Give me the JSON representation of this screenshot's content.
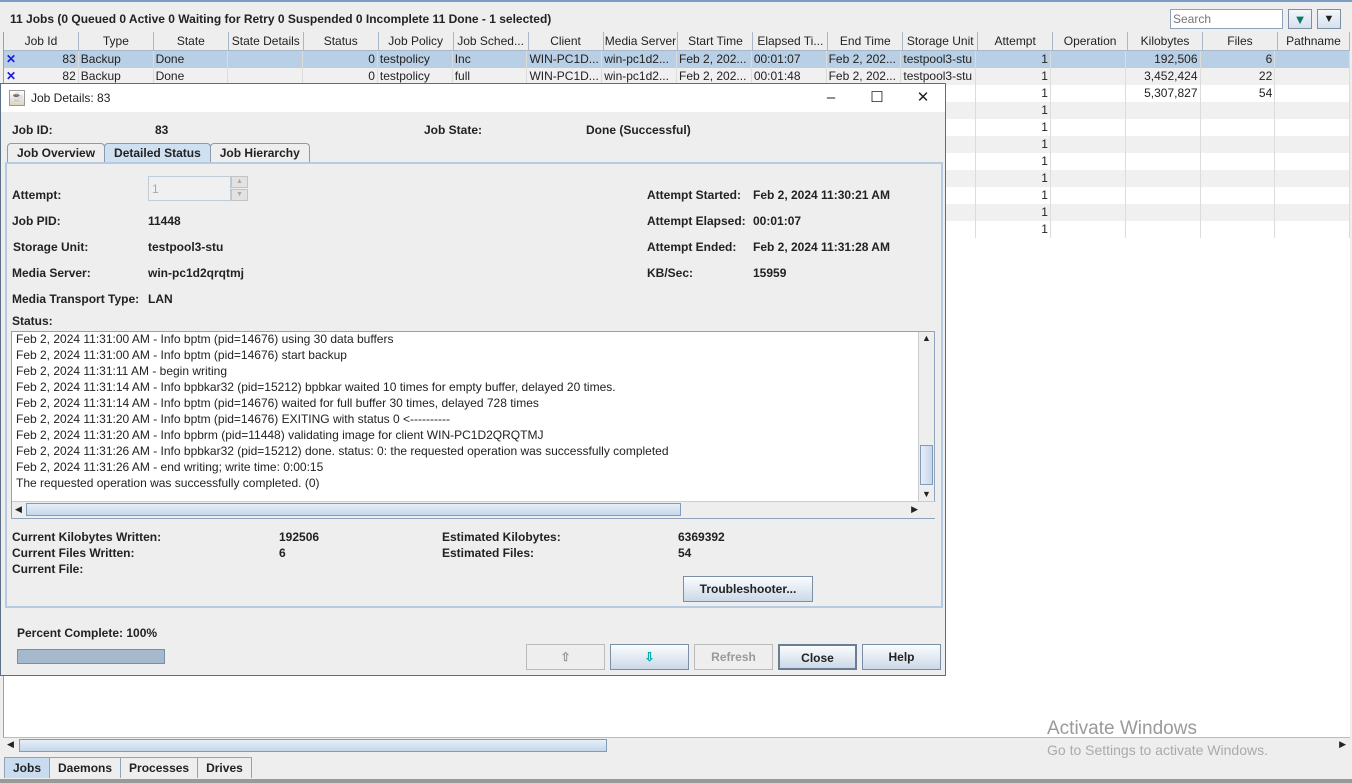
{
  "summary": "11 Jobs (0 Queued 0 Active 0 Waiting for Retry 0 Suspended 0 Incomplete 11 Done - 1 selected)",
  "search": {
    "placeholder": "Search"
  },
  "table": {
    "columns": [
      "Job Id",
      "Type",
      "State",
      "State Details",
      "Status",
      "Job Policy",
      "Job Sched...",
      "Client",
      "Media Server",
      "Start Time",
      "Elapsed Ti...",
      "End Time",
      "Storage Unit",
      "Attempt",
      "Operation",
      "Kilobytes",
      "Files",
      "Pathname"
    ],
    "rows": [
      [
        "83",
        "Backup",
        "Done",
        "",
        "0",
        "testpolicy",
        "Inc",
        "WIN-PC1D...",
        "win-pc1d2...",
        "Feb 2, 202...",
        "00:01:07",
        "Feb 2, 202...",
        "testpool3-stu",
        "1",
        "",
        "192,506",
        "6",
        ""
      ],
      [
        "82",
        "Backup",
        "Done",
        "",
        "0",
        "testpolicy",
        "full",
        "WIN-PC1D...",
        "win-pc1d2...",
        "Feb 2, 202...",
        "00:01:48",
        "Feb 2, 202...",
        "testpool3-stu",
        "1",
        "",
        "3,452,424",
        "22",
        ""
      ],
      [
        "",
        "",
        "",
        "",
        "",
        "",
        "",
        "",
        "",
        "",
        "",
        "",
        "l3-stu",
        "1",
        "",
        "5,307,827",
        "54",
        ""
      ],
      [
        "",
        "",
        "",
        "",
        "",
        "",
        "",
        "",
        "",
        "",
        "",
        "",
        "",
        "1",
        "",
        "",
        "",
        ""
      ],
      [
        "",
        "",
        "",
        "",
        "",
        "",
        "",
        "",
        "",
        "",
        "",
        "",
        "",
        "1",
        "",
        "",
        "",
        ""
      ],
      [
        "",
        "",
        "",
        "",
        "",
        "",
        "",
        "",
        "",
        "",
        "",
        "",
        "",
        "1",
        "",
        "",
        "",
        ""
      ],
      [
        "",
        "",
        "",
        "",
        "",
        "",
        "",
        "",
        "",
        "",
        "",
        "",
        "",
        "1",
        "",
        "",
        "",
        ""
      ],
      [
        "",
        "",
        "",
        "",
        "",
        "",
        "",
        "",
        "",
        "",
        "",
        "",
        "",
        "1",
        "",
        "",
        "",
        ""
      ],
      [
        "",
        "",
        "",
        "",
        "",
        "",
        "",
        "",
        "",
        "",
        "",
        "",
        "",
        "1",
        "",
        "",
        "",
        ""
      ],
      [
        "",
        "",
        "",
        "",
        "",
        "",
        "",
        "",
        "",
        "",
        "",
        "",
        "",
        "1",
        "",
        "",
        "",
        ""
      ],
      [
        "",
        "",
        "",
        "",
        "",
        "",
        "",
        "",
        "",
        "",
        "",
        "",
        "",
        "1",
        "",
        "",
        "",
        ""
      ]
    ],
    "selected_row": 0
  },
  "bottom_tabs": [
    "Jobs",
    "Daemons",
    "Processes",
    "Drives"
  ],
  "dialog": {
    "title": "Job Details: 83",
    "job_id_label": "Job ID:",
    "job_id": "83",
    "job_state_label": "Job State:",
    "job_state": "Done (Successful)",
    "tabs": [
      "Job Overview",
      "Detailed Status",
      "Job Hierarchy"
    ],
    "active_tab": "Detailed Status",
    "attempt_label": "Attempt:",
    "attempt": "1",
    "job_pid_label": "Job PID:",
    "job_pid": "11448",
    "storage_unit_label": "Storage Unit:",
    "storage_unit": "testpool3-stu",
    "media_server_label": "Media Server:",
    "media_server": "win-pc1d2qrqtmj",
    "transport_label": "Media Transport Type:",
    "transport": "LAN",
    "attempt_started_label": "Attempt Started:",
    "attempt_started": "Feb 2, 2024 11:30:21 AM",
    "attempt_elapsed_label": "Attempt Elapsed:",
    "attempt_elapsed": "00:01:07",
    "attempt_ended_label": "Attempt Ended:",
    "attempt_ended": "Feb 2, 2024 11:31:28 AM",
    "kbsec_label": "KB/Sec:",
    "kbsec": "15959",
    "status_label": "Status:",
    "log": [
      "Feb 2, 2024 11:31:00 AM - Info bptm (pid=14676) using 30 data buffers",
      "Feb 2, 2024 11:31:00 AM - Info bptm (pid=14676) start backup",
      "Feb 2, 2024 11:31:11 AM - begin writing",
      "Feb 2, 2024 11:31:14 AM - Info bpbkar32 (pid=15212) bpbkar waited 10 times for empty buffer, delayed 20 times.",
      "Feb 2, 2024 11:31:14 AM - Info bptm (pid=14676) waited for full buffer 30 times, delayed 728 times",
      "Feb 2, 2024 11:31:20 AM - Info bptm (pid=14676) EXITING with status 0 <----------",
      "Feb 2, 2024 11:31:20 AM - Info bpbrm (pid=11448) validating image for client WIN-PC1D2QRQTMJ",
      "Feb 2, 2024 11:31:26 AM - Info bpbkar32 (pid=15212) done. status: 0: the requested operation was successfully completed",
      "Feb 2, 2024 11:31:26 AM - end writing; write time: 0:00:15",
      "The requested operation was successfully completed.  (0)"
    ],
    "kb_written_label": "Current Kilobytes Written:",
    "kb_written": "192506",
    "files_written_label": "Current Files Written:",
    "files_written": "6",
    "current_file_label": "Current File:",
    "est_kb_label": "Estimated Kilobytes:",
    "est_kb": "6369392",
    "est_files_label": "Estimated Files:",
    "est_files": "54",
    "troubleshooter": "Troubleshooter...",
    "percent_label": "Percent Complete: 100%",
    "percent_complete": 100,
    "refresh": "Refresh",
    "close": "Close",
    "help": "Help"
  },
  "watermark": {
    "line1": "Activate Windows",
    "line2": "Go to Settings to activate Windows."
  },
  "colors": {
    "selection": "#b8cfe5",
    "accent": "#7a9cc6"
  }
}
